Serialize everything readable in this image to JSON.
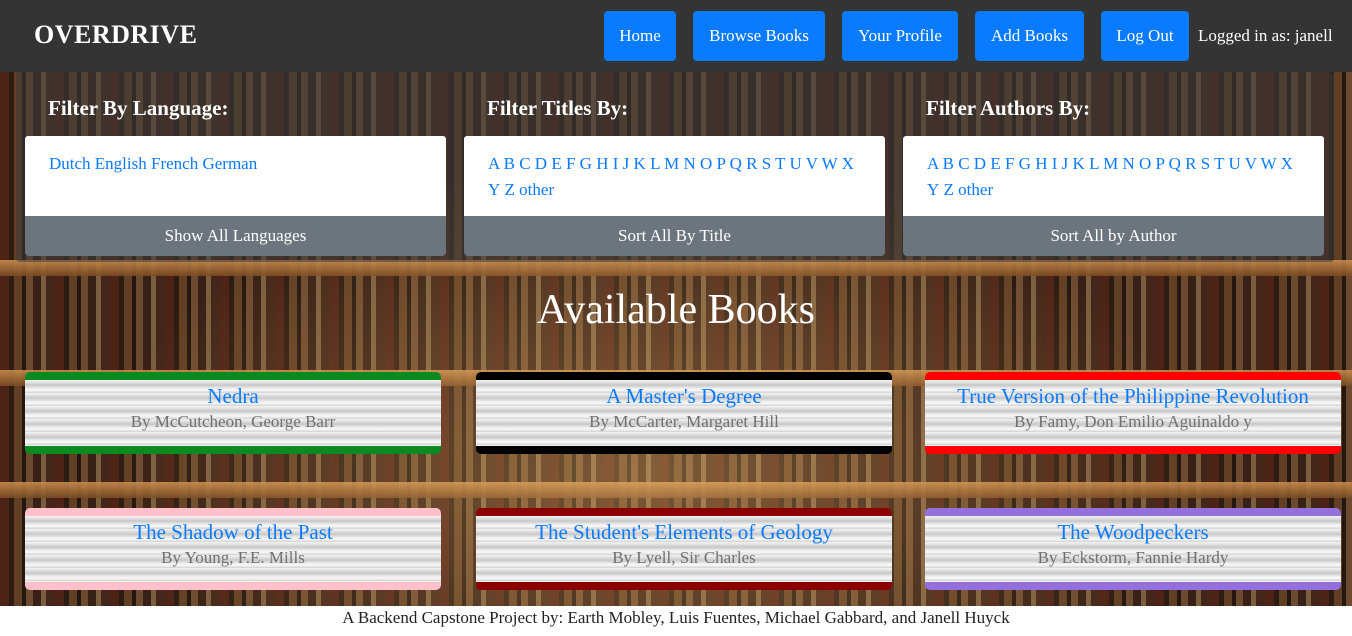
{
  "navbar": {
    "brand": "OVERDRIVE",
    "buttons": [
      "Home",
      "Browse Books",
      "Your Profile",
      "Add Books",
      "Log Out"
    ],
    "logged_in": "Logged in as: janell"
  },
  "filters": {
    "language": {
      "title": "Filter By Language:",
      "items": [
        "Dutch",
        "English",
        "French",
        "German"
      ],
      "button": "Show All Languages"
    },
    "titles": {
      "title": "Filter Titles By:",
      "letters": [
        "A",
        "B",
        "C",
        "D",
        "E",
        "F",
        "G",
        "H",
        "I",
        "J",
        "K",
        "L",
        "M",
        "N",
        "O",
        "P",
        "Q",
        "R",
        "S",
        "T",
        "U",
        "V",
        "W",
        "X",
        "Y",
        "Z",
        "other"
      ],
      "button": "Sort All By Title"
    },
    "authors": {
      "title": "Filter Authors By:",
      "letters": [
        "A",
        "B",
        "C",
        "D",
        "E",
        "F",
        "G",
        "H",
        "I",
        "J",
        "K",
        "L",
        "M",
        "N",
        "O",
        "P",
        "Q",
        "R",
        "S",
        "T",
        "U",
        "V",
        "W",
        "X",
        "Y",
        "Z",
        "other"
      ],
      "button": "Sort All by Author"
    }
  },
  "main": {
    "heading": "Available Books",
    "books": [
      {
        "title": "Nedra",
        "author": "By McCutcheon, George Barr",
        "color": "#0b8a1f"
      },
      {
        "title": "A Master's Degree",
        "author": "By McCarter, Margaret Hill",
        "color": "#000000"
      },
      {
        "title": "True Version of the Philippine Revolution",
        "author": "By Famy, Don Emilio Aguinaldo y",
        "color": "#ff0000"
      },
      {
        "title": "The Shadow of the Past",
        "author": "By Young, F.E. Mills",
        "color": "#ffc0cb"
      },
      {
        "title": "The Student's Elements of Geology",
        "author": "By Lyell, Sir Charles",
        "color": "#8b0000"
      },
      {
        "title": "The Woodpeckers",
        "author": "By Eckstorm, Fannie Hardy",
        "color": "#9370db"
      }
    ]
  },
  "footer": {
    "text": "A Backend Capstone Project by: Earth Mobley, Luis Fuentes, Michael Gabbard, and Janell Huyck"
  }
}
